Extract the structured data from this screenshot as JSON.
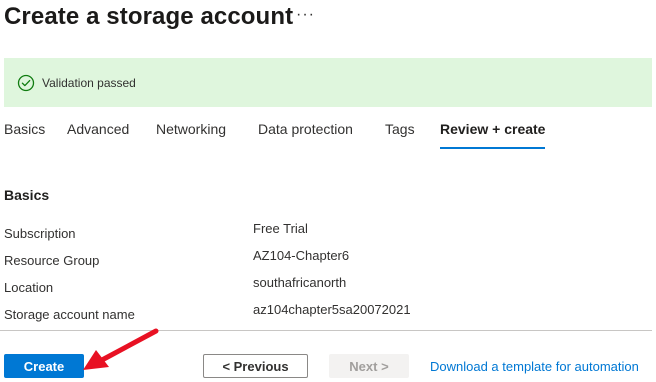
{
  "header": {
    "title": "Create a storage account",
    "more_label": "···"
  },
  "banner": {
    "icon": "check-circle-icon",
    "text": "Validation passed",
    "color": "#dff6dd"
  },
  "tabs": [
    {
      "label": "Basics",
      "active": false
    },
    {
      "label": "Advanced",
      "active": false
    },
    {
      "label": "Networking",
      "active": false
    },
    {
      "label": "Data protection",
      "active": false
    },
    {
      "label": "Tags",
      "active": false
    },
    {
      "label": "Review + create",
      "active": true
    }
  ],
  "summary": {
    "section_title": "Basics",
    "rows": [
      {
        "label": "Subscription",
        "value": "Free Trial"
      },
      {
        "label": "Resource Group",
        "value": "AZ104-Chapter6"
      },
      {
        "label": "Location",
        "value": "southafricanorth"
      },
      {
        "label": "Storage account name",
        "value": "az104chapter5sa20072021"
      }
    ]
  },
  "footer": {
    "create_label": "Create",
    "previous_label": "< Previous",
    "next_label": "Next >",
    "download_label": "Download a template for automation"
  },
  "annotation": {
    "icon": "red-arrow-icon",
    "color": "#e81123"
  },
  "colors": {
    "accent": "#0078d4",
    "success": "#107c10"
  }
}
